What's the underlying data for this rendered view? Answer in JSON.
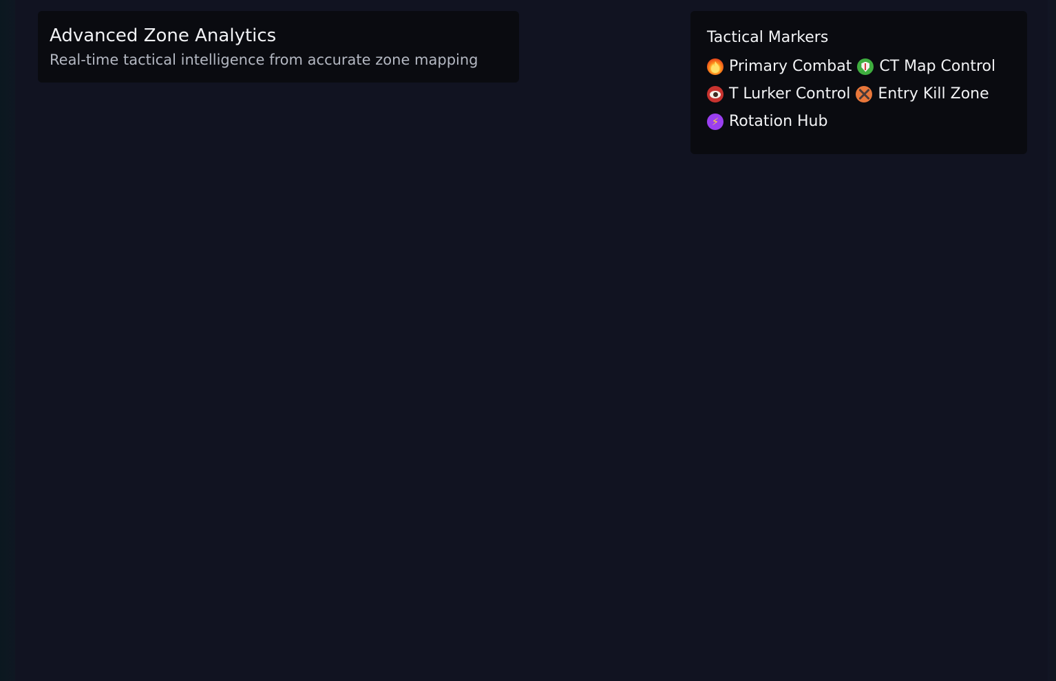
{
  "header": {
    "title": "Advanced Zone Analytics",
    "subtitle": "Real-time tactical intelligence from accurate zone mapping"
  },
  "legend": {
    "title": "Tactical Markers",
    "items": [
      {
        "label": "Primary Combat",
        "icon": "fire-icon",
        "color": "#e5451a"
      },
      {
        "label": "CT Map Control",
        "icon": "shield-icon",
        "color": "#3fae3f"
      },
      {
        "label": "T Lurker Control",
        "icon": "eye-icon",
        "color": "#c8332f"
      },
      {
        "label": "Entry Kill Zone",
        "icon": "crossed-swords-icon",
        "color": "#e9773a"
      },
      {
        "label": "Rotation Hub",
        "icon": "lightning-icon",
        "color": "#9a3ff0"
      }
    ]
  },
  "colors": {
    "background": "#111321",
    "panel": "#0a0b10"
  }
}
